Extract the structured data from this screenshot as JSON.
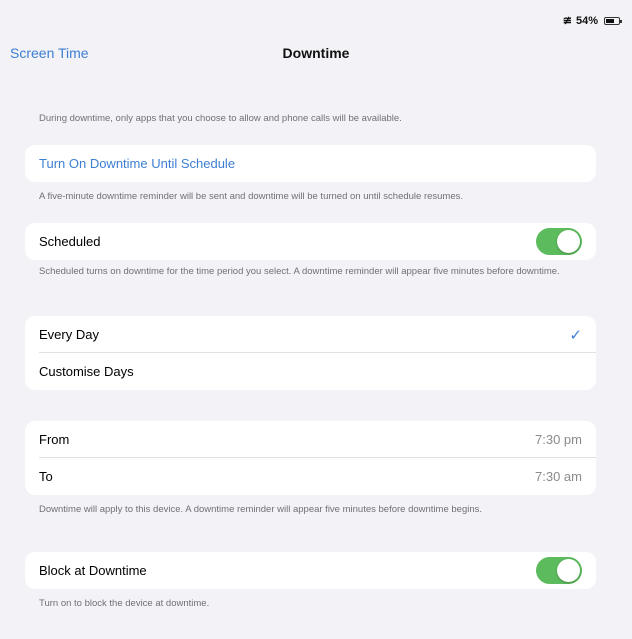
{
  "status_bar": {
    "battery": "54%",
    "wifi_icon": "wifi-icon"
  },
  "nav": {
    "back_label": "Screen Time",
    "title": "Downtime"
  },
  "intro": "During downtime, only apps that you choose to allow and phone calls will be available.",
  "turn_on": {
    "label": "Turn On Downtime Until Schedule",
    "footer": "A five-minute downtime reminder will be sent and downtime will be turned on until schedule resumes."
  },
  "scheduled": {
    "label": "Scheduled",
    "enabled": true,
    "footer": "Scheduled turns on downtime for the time period you select. A downtime reminder will appear five minutes before downtime."
  },
  "day_options": [
    {
      "label": "Every Day",
      "selected": true
    },
    {
      "label": "Customise Days",
      "selected": false
    }
  ],
  "time": {
    "from_label": "From",
    "from_value": "7:30 pm",
    "to_label": "To",
    "to_value": "7:30 am",
    "footer": "Downtime will apply to this device. A downtime reminder will appear five minutes before downtime begins."
  },
  "block": {
    "label": "Block at Downtime",
    "enabled": true,
    "footer": "Turn on to block the device at downtime."
  },
  "colors": {
    "accent": "#3d7fd3",
    "toggle_on": "#5cbb5c",
    "background": "#f2f2f7"
  }
}
